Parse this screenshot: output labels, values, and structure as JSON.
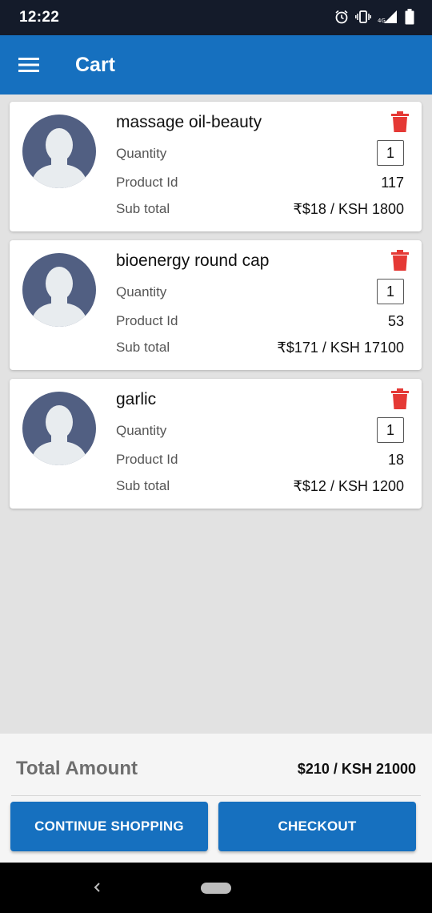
{
  "status_bar": {
    "time": "12:22",
    "icons": [
      "alarm-icon",
      "vibrate-icon",
      "4g-signal-icon",
      "battery-icon"
    ],
    "network_label": "4G"
  },
  "app_bar": {
    "title": "Cart",
    "menu_icon": "hamburger-menu-icon",
    "color": "#1670bf"
  },
  "cart": {
    "items": [
      {
        "name": "massage oil-beauty",
        "quantity_label": "Quantity",
        "quantity": "1",
        "product_id_label": "Product Id",
        "product_id": "117",
        "subtotal_label": "Sub total",
        "subtotal": "₹$18 /  KSH 1800",
        "avatar_icon": "person-placeholder-icon",
        "delete_icon": "trash-icon"
      },
      {
        "name": "bioenergy round cap",
        "quantity_label": "Quantity",
        "quantity": "1",
        "product_id_label": "Product Id",
        "product_id": "53",
        "subtotal_label": "Sub total",
        "subtotal": "₹$171 /  KSH 17100",
        "avatar_icon": "person-placeholder-icon",
        "delete_icon": "trash-icon"
      },
      {
        "name": "garlic",
        "quantity_label": "Quantity",
        "quantity": "1",
        "product_id_label": "Product Id",
        "product_id": "18",
        "subtotal_label": "Sub total",
        "subtotal": "₹$12 /  KSH 1200",
        "avatar_icon": "person-placeholder-icon",
        "delete_icon": "trash-icon"
      }
    ]
  },
  "footer": {
    "total_label": "Total Amount",
    "total_value": "$210 / KSH 21000",
    "continue_label": "CONTINUE SHOPPING",
    "checkout_label": "CHECKOUT"
  },
  "nav_bar": {
    "icons": [
      "back-icon",
      "home-pill-icon"
    ]
  },
  "colors": {
    "primary": "#1670bf",
    "delete": "#e53935",
    "avatar_bg": "#515f82",
    "status_bar": "#141b2a"
  }
}
